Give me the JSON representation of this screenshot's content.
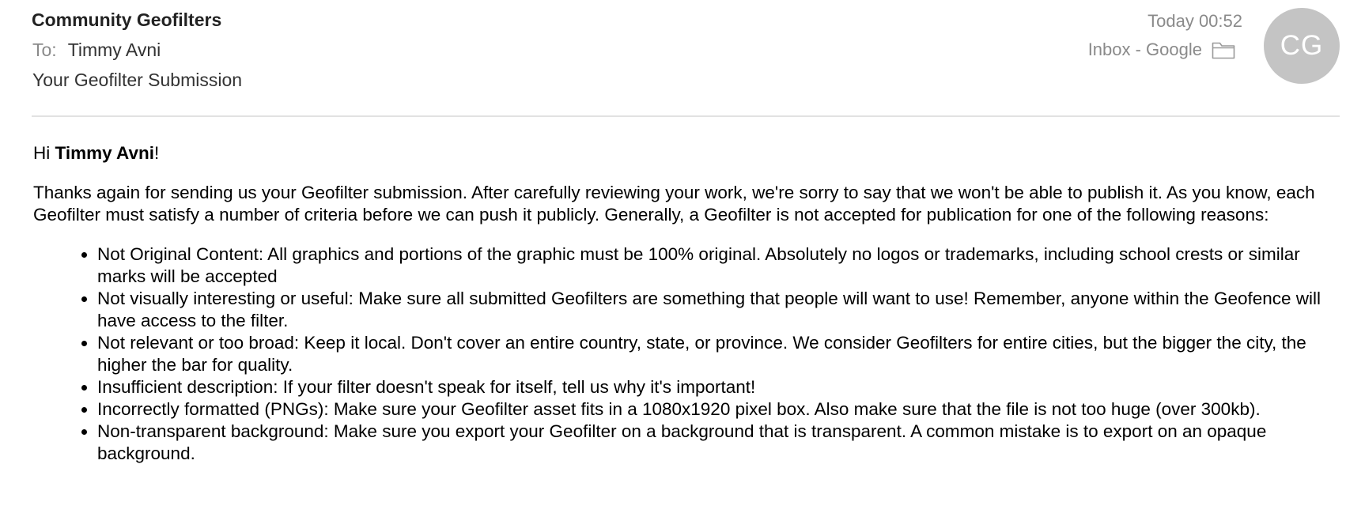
{
  "email": {
    "sender": "Community Geofilters",
    "to_label": "To:",
    "to_name": "Timmy Avni",
    "subject": "Your Geofilter Submission",
    "date": "Today 00:52",
    "mailbox": "Inbox - Google",
    "avatar_initials": "CG",
    "avatar_color": "#c4c4c4"
  },
  "body": {
    "greeting_prefix": "Hi ",
    "greeting_name": "Timmy Avni",
    "greeting_suffix": "!",
    "paragraph": "Thanks again for sending us your Geofilter submission. After carefully reviewing your work, we're sorry to say that we won't be able to publish it. As you know, each Geofilter must satisfy a number of criteria before we can push it publicly. Generally, a Geofilter is not accepted for publication for one of the following reasons:",
    "reasons": [
      "Not Original Content: All graphics and portions of the graphic must be 100% original. Absolutely no logos or trademarks, including school crests or similar marks will be accepted",
      "Not visually interesting or useful: Make sure all submitted Geofilters are something that people will want to use! Remember, anyone within the Geofence will have access to the filter.",
      "Not relevant or too broad: Keep it local. Don't cover an entire country, state, or province. We consider Geofilters for entire cities, but the bigger the city, the higher the bar for quality.",
      "Insufficient description: If your filter doesn't speak for itself, tell us why it's important!",
      "Incorrectly formatted (PNGs): Make sure your Geofilter asset fits in a 1080x1920 pixel box. Also make sure that the file is not too huge (over 300kb).",
      "Non-transparent background: Make sure you export your Geofilter on a background that is transparent. A common mistake is to export on an opaque background."
    ]
  },
  "icons": {
    "mailbox_icon": "folder-icon"
  }
}
